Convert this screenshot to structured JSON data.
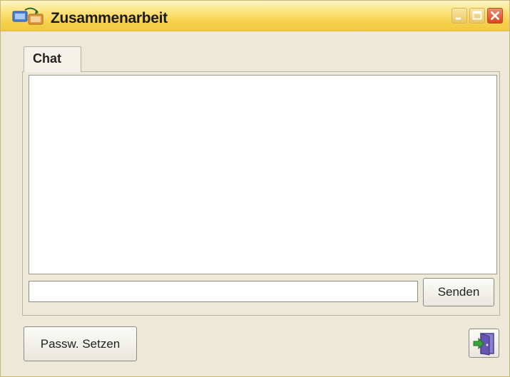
{
  "window": {
    "title": "Zusammenarbeit",
    "controls": {
      "minimize": "minimize-icon",
      "maximize": "maximize-icon",
      "close": "close-icon"
    }
  },
  "tabs": [
    {
      "label": "Chat",
      "active": true
    }
  ],
  "chat": {
    "messages": [],
    "input_value": "",
    "send_label": "Senden"
  },
  "footer": {
    "set_password_label": "Passw. Setzen",
    "exit_icon": "exit-door-icon"
  },
  "colors": {
    "titlebar": "#f6d24f",
    "window_bg": "#ece9d8",
    "close_button": "#d9451f"
  }
}
